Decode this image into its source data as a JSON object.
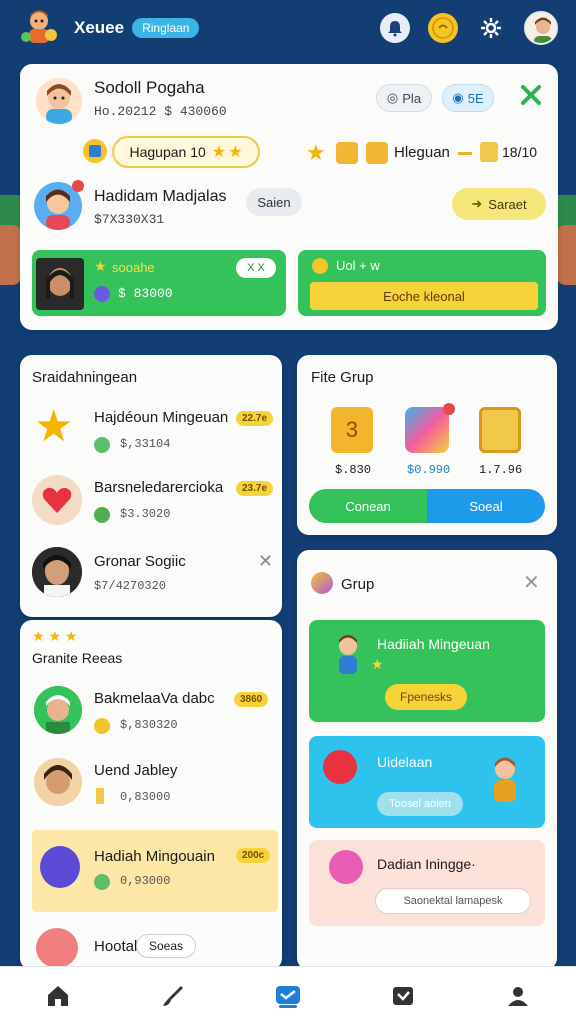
{
  "app": {
    "name": "Xeuee",
    "pill": "Ringlaan"
  },
  "profile": {
    "name": "Sodoll Pogaha",
    "meta": "Ho.20212 $ 430060",
    "chip1": "Pla",
    "chip2": "5E",
    "hagupan": "Hagupan 10",
    "hleguan": "Hleguan",
    "hleguan_value": "18/10",
    "friend_name": "Hadidam Madjalas",
    "friend_meta": "$7X330X31",
    "friend_tag": "Saien",
    "friend_button": "Saraet",
    "green_left_label": "sooahe",
    "green_left_x": "X X",
    "green_left_value": "$ 83000",
    "green_right_label": "Uol + w",
    "green_right_button": "Eoche kleonal"
  },
  "summary": {
    "title": "Sraidahningean",
    "items": [
      {
        "title": "Hajdéoun Mingeuan",
        "badge": "22.7e",
        "sub": "$,33104"
      },
      {
        "title": "Barsneledarercioka",
        "badge": "23.7e",
        "sub": "$3.3020"
      },
      {
        "title": "Gronar Sogiic",
        "sub": "$7/4270320"
      }
    ]
  },
  "fite": {
    "title": "Fite Grup",
    "items": [
      {
        "value": "$.830"
      },
      {
        "value": "$0.990"
      },
      {
        "value": "1.7.96"
      }
    ],
    "button_left": "Conean",
    "button_right": "Soeal"
  },
  "grup": {
    "title": "Grup",
    "panels": [
      {
        "title": "Hadiiah Mingeuan",
        "button": "Fpenesks"
      },
      {
        "title": "Uidelaan",
        "button": "Toosel aolen"
      },
      {
        "title": "Dadian Iningge·",
        "button": "Saonektal lamapesk"
      }
    ]
  },
  "rewards": {
    "title": "Granite Reeas",
    "items": [
      {
        "title": "BakmelaaVa dabc",
        "badge": "3860",
        "sub": "$,830320"
      },
      {
        "title": "Uend Jabley",
        "sub": "0,83000"
      },
      {
        "title": "Hadiah Mingouain",
        "badge": "200c",
        "sub": "0,93000"
      },
      {
        "title": "Hootal",
        "chip": "Soeas"
      }
    ]
  },
  "colors": {
    "navy": "#123e74",
    "green": "#36c25a",
    "yellow": "#f7d33a",
    "blue": "#1e9be8",
    "cyan": "#2ec3ec",
    "peach": "#fbe1d8"
  },
  "nav": [
    "home-icon",
    "brush-icon",
    "chat-icon",
    "task-icon",
    "profile-icon"
  ]
}
